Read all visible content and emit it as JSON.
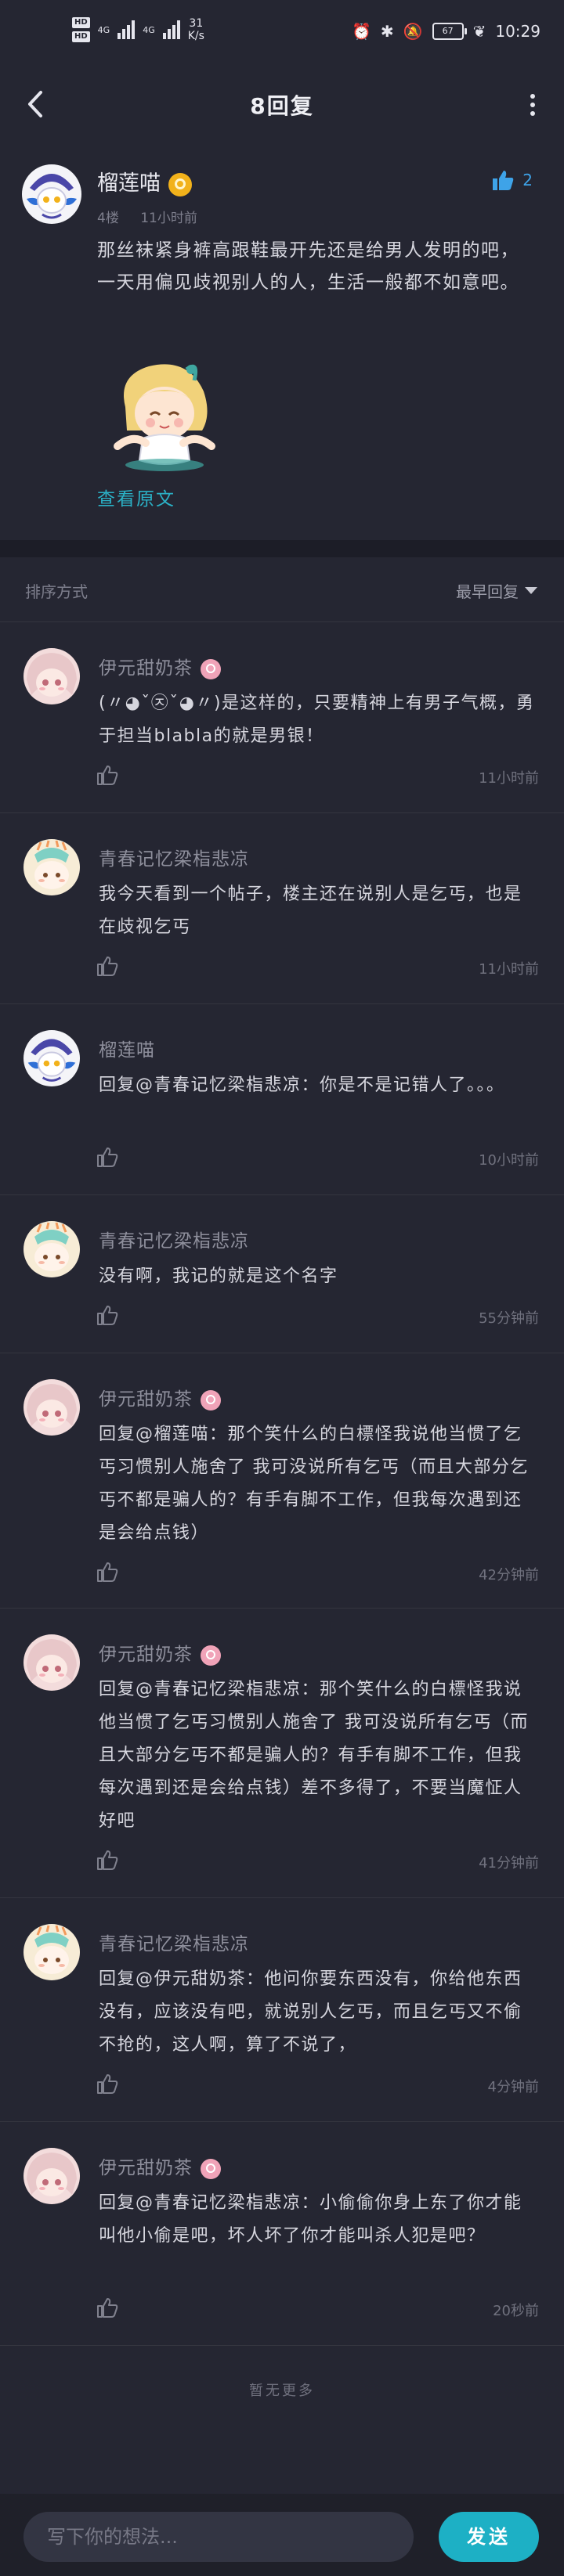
{
  "status_bar": {
    "hd1": "HD",
    "hd2": "HD",
    "net1": "4G",
    "net2": "4G",
    "speed_value": "31",
    "speed_unit": "K/s",
    "battery": "67",
    "time": "10:29"
  },
  "header": {
    "title": "8回复"
  },
  "post": {
    "username": "榴莲喵",
    "floor": "4楼",
    "time": "11小时前",
    "like_count": "2",
    "content": "那丝袜紧身裤高跟鞋最开先还是给男人发明的吧，一天用偏见歧视别人的人，生活一般都不如意吧。",
    "view_original": "查看原文"
  },
  "sort": {
    "label": "排序方式",
    "value": "最早回复"
  },
  "replies": [
    {
      "username": "伊元甜奶茶",
      "content": "(〃◕ˇ㉨ˇ◕〃)是这样的，只要精神上有男子气概，勇于担当blabla的就是男银！",
      "time": "11小时前",
      "has_badge": true
    },
    {
      "username": "青春记忆梁栺悲凉",
      "content": "我今天看到一个帖子，楼主还在说别人是乞丐，也是在歧视乞丐",
      "time": "11小时前",
      "has_badge": false
    },
    {
      "username": "榴莲喵",
      "content": "回复@青春记忆梁栺悲凉：你是不是记错人了。。。",
      "time": "10小时前",
      "has_badge": false
    },
    {
      "username": "青春记忆梁栺悲凉",
      "content": "没有啊，我记的就是这个名字",
      "time": "55分钟前",
      "has_badge": false
    },
    {
      "username": "伊元甜奶茶",
      "content": "回复@榴莲喵：那个笑什么的白標怪我说他当惯了乞丐习惯别人施舍了 我可没说所有乞丐（而且大部分乞丐不都是骗人的？有手有脚不工作，但我每次遇到还是会给点钱）",
      "time": "42分钟前",
      "has_badge": true
    },
    {
      "username": "伊元甜奶茶",
      "content": "回复@青春记忆梁栺悲凉：那个笑什么的白標怪我说他当惯了乞丐习惯别人施舍了 我可没说所有乞丐（而且大部分乞丐不都是骗人的？有手有脚不工作，但我每次遇到还是会给点钱）差不多得了，不要当魔怔人好吧",
      "time": "41分钟前",
      "has_badge": true
    },
    {
      "username": "青春记忆梁栺悲凉",
      "content": "回复@伊元甜奶茶：他问你要东西没有，你给他东西没有，应该没有吧，就说别人乞丐，而且乞丐又不偷不抢的，这人啊，算了不说了，",
      "time": "4分钟前",
      "has_badge": false
    },
    {
      "username": "伊元甜奶茶",
      "content": "回复@青春记忆梁栺悲凉：小偷偷你身上东了你才能叫他小偷是吧，坏人坏了你才能叫杀人犯是吧？",
      "time": "20秒前",
      "has_badge": true
    }
  ],
  "no_more": "暂无更多",
  "composer": {
    "placeholder": "写下你的想法...",
    "send_label": "发送"
  },
  "colors": {
    "background": "#252632",
    "accent": "#1db0c5",
    "like_blue": "#3ea3e8"
  }
}
